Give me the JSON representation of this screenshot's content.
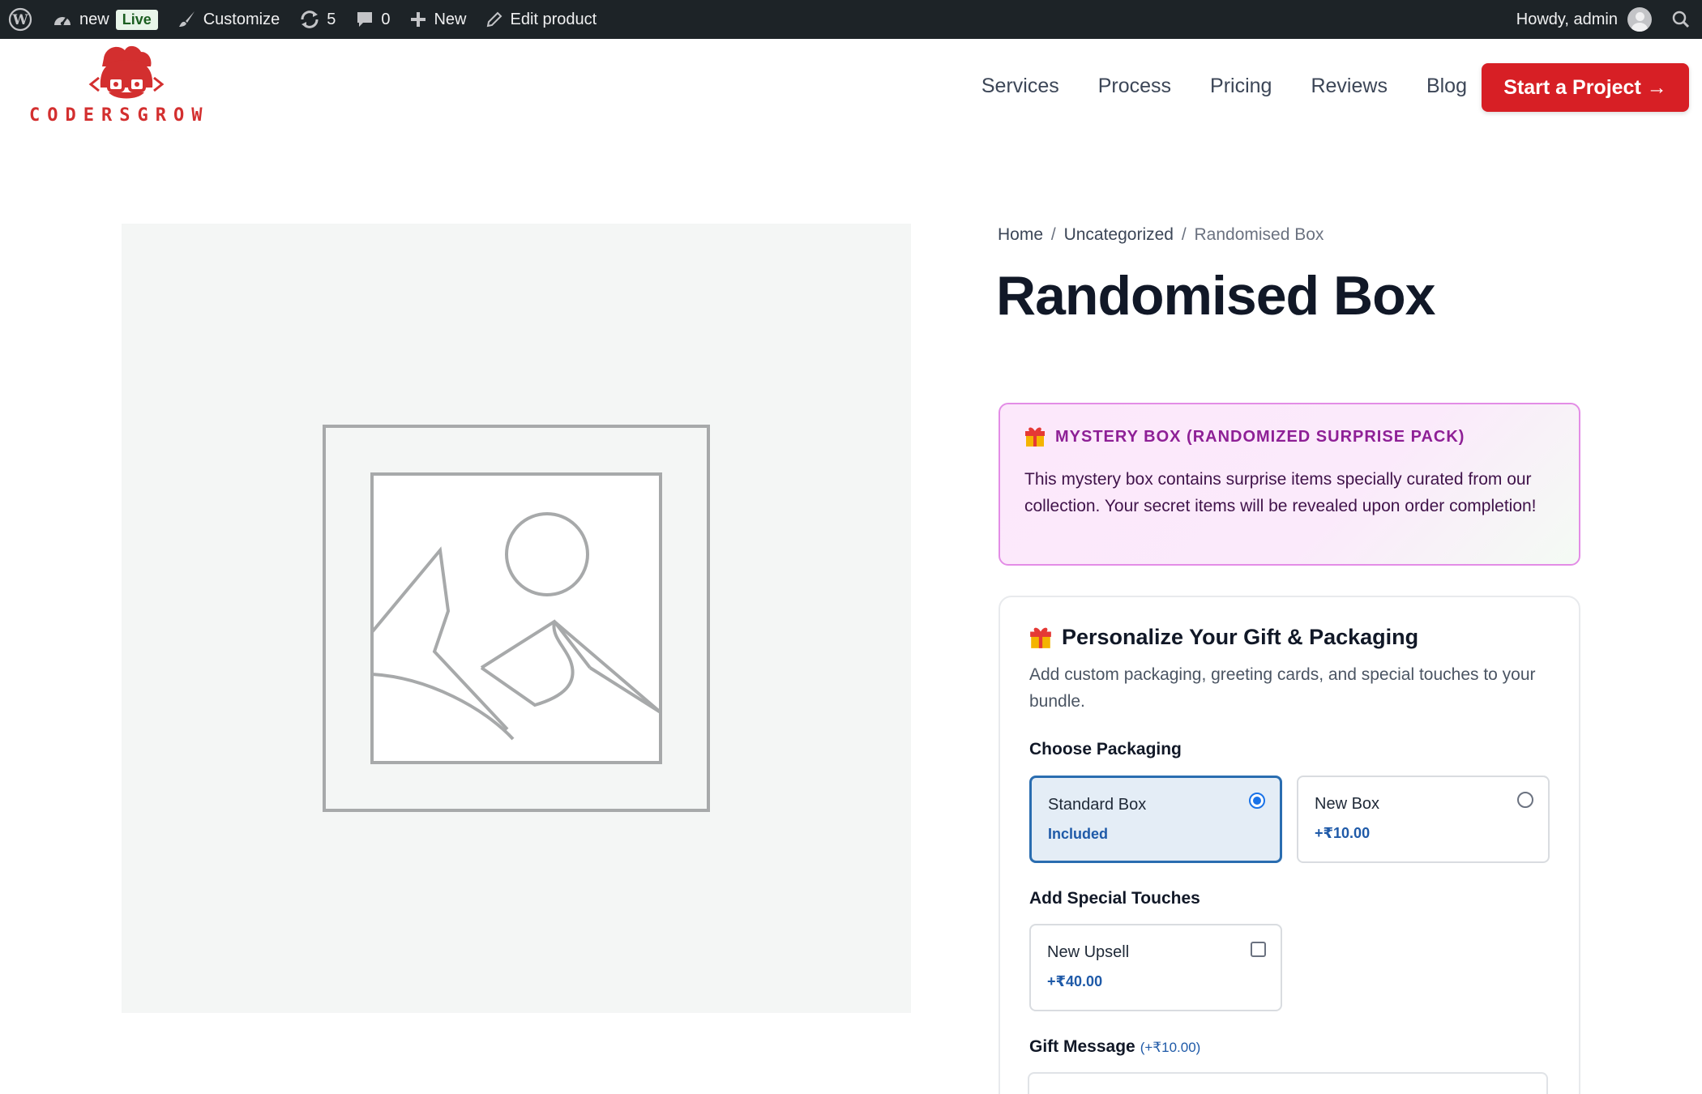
{
  "admin_bar": {
    "site_name": "new",
    "live_badge": "Live",
    "customize": "Customize",
    "updates_count": "5",
    "comments_count": "0",
    "new_label": "New",
    "edit_product": "Edit product",
    "howdy": "Howdy, admin"
  },
  "header": {
    "logo_text": "CODERSGROW",
    "nav": [
      "Services",
      "Process",
      "Pricing",
      "Reviews",
      "Blog"
    ],
    "cta": "Start a Project →"
  },
  "breadcrumb": {
    "home": "Home",
    "category": "Uncategorized",
    "current": "Randomised Box",
    "separator": "/"
  },
  "product": {
    "title": "Randomised Box"
  },
  "mystery_box": {
    "heading": "MYSTERY BOX (RANDOMIZED SURPRISE PACK)",
    "body": "This mystery box contains surprise items specially curated from our collection. Your secret items will be revealed upon order completion!"
  },
  "personalize": {
    "title": "Personalize Your Gift & Packaging",
    "subtitle": "Add custom packaging, greeting cards, and special touches to your bundle.",
    "packaging_label": "Choose Packaging",
    "packaging_options": [
      {
        "name": "Standard Box",
        "price": "Included",
        "selected": true
      },
      {
        "name": "New Box",
        "price": "+₹10.00",
        "selected": false
      }
    ],
    "touches_label": "Add Special Touches",
    "touches": [
      {
        "name": "New Upsell",
        "price": "+₹40.00",
        "checked": false
      }
    ],
    "gift_message_label": "Gift Message",
    "gift_message_price": "(+₹10.00)"
  },
  "colors": {
    "brand_red": "#d71f25",
    "admin_bar": "#1d2327",
    "mystery_accent": "#8e2096",
    "selected_blue": "#2a6db0"
  }
}
